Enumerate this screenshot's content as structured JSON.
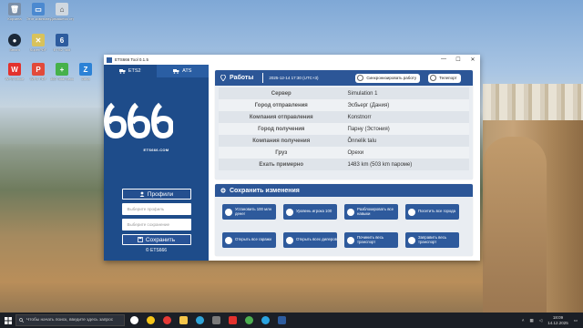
{
  "desktop": {
    "icons": [
      {
        "label": "Корзина",
        "color": "#7a8fa8"
      },
      {
        "label": "Этот компьютер",
        "color": "#4b89d0"
      },
      {
        "label": "Домашняя страница",
        "color": "#d0d8e0"
      },
      {
        "label": "Steam",
        "color": "#1b2838"
      },
      {
        "label": "SuperPDF",
        "color": "#d8c25b"
      },
      {
        "label": "ETS2 Tool",
        "color": "#2d5c9e"
      },
      {
        "label": "WPS Office",
        "color": "#e3322d"
      },
      {
        "label": "WPS PDF",
        "color": "#e24a3a"
      },
      {
        "label": "360 Total Security",
        "color": "#46b14a"
      },
      {
        "label": "Zona",
        "color": "#2c82d6"
      }
    ]
  },
  "window": {
    "title": "ETS666 Tool 0.1.5",
    "minimize": "—",
    "maximize": "☐",
    "close": "✕"
  },
  "sidebar": {
    "tabs": [
      {
        "label": "ETS2"
      },
      {
        "label": "ATS"
      }
    ],
    "logo_text": "ETS666.COM",
    "profiles_label": "Профили",
    "profile_placeholder": "Выберите профиль",
    "save_placeholder": "Выберите сохранение",
    "save_label": "Сохранить",
    "copyright": "© ETS666"
  },
  "jobs": {
    "title": "Работы",
    "datetime": "2025-12-14 17:30 (UTC+3)",
    "sync_label": "Синхронизировать работу",
    "teleport_label": "Телепорт",
    "rows": [
      {
        "key": "Сервер",
        "value": "Simulation 1"
      },
      {
        "key": "Город отправления",
        "value": "Эсбьерг (Дания)"
      },
      {
        "key": "Компания отправления",
        "value": "Konstnorr"
      },
      {
        "key": "Город получения",
        "value": "Парну (Эстония)"
      },
      {
        "key": "Компания получения",
        "value": "Õnnelik talu"
      },
      {
        "key": "Груз",
        "value": "Орехи"
      },
      {
        "key": "Ехать примерно",
        "value": "1483 km (503 km пароме)"
      }
    ]
  },
  "save_changes": {
    "title": "Сохранить изменения",
    "buttons": [
      {
        "label": "Установить 100 млн денег"
      },
      {
        "label": "Уровень игрока 100"
      },
      {
        "label": "Разблокировать все навыки"
      },
      {
        "label": "Посетить все города"
      },
      {
        "label": "Открыть все гаражи"
      },
      {
        "label": "Открыть всех дилеров"
      },
      {
        "label": "Починить весь транспорт"
      },
      {
        "label": "Заправить весь транспорт"
      }
    ]
  },
  "taskbar": {
    "search_placeholder": "Чтобы начать поиск, введите здесь запрос",
    "time": "18:09",
    "date": "14.12.2025"
  }
}
